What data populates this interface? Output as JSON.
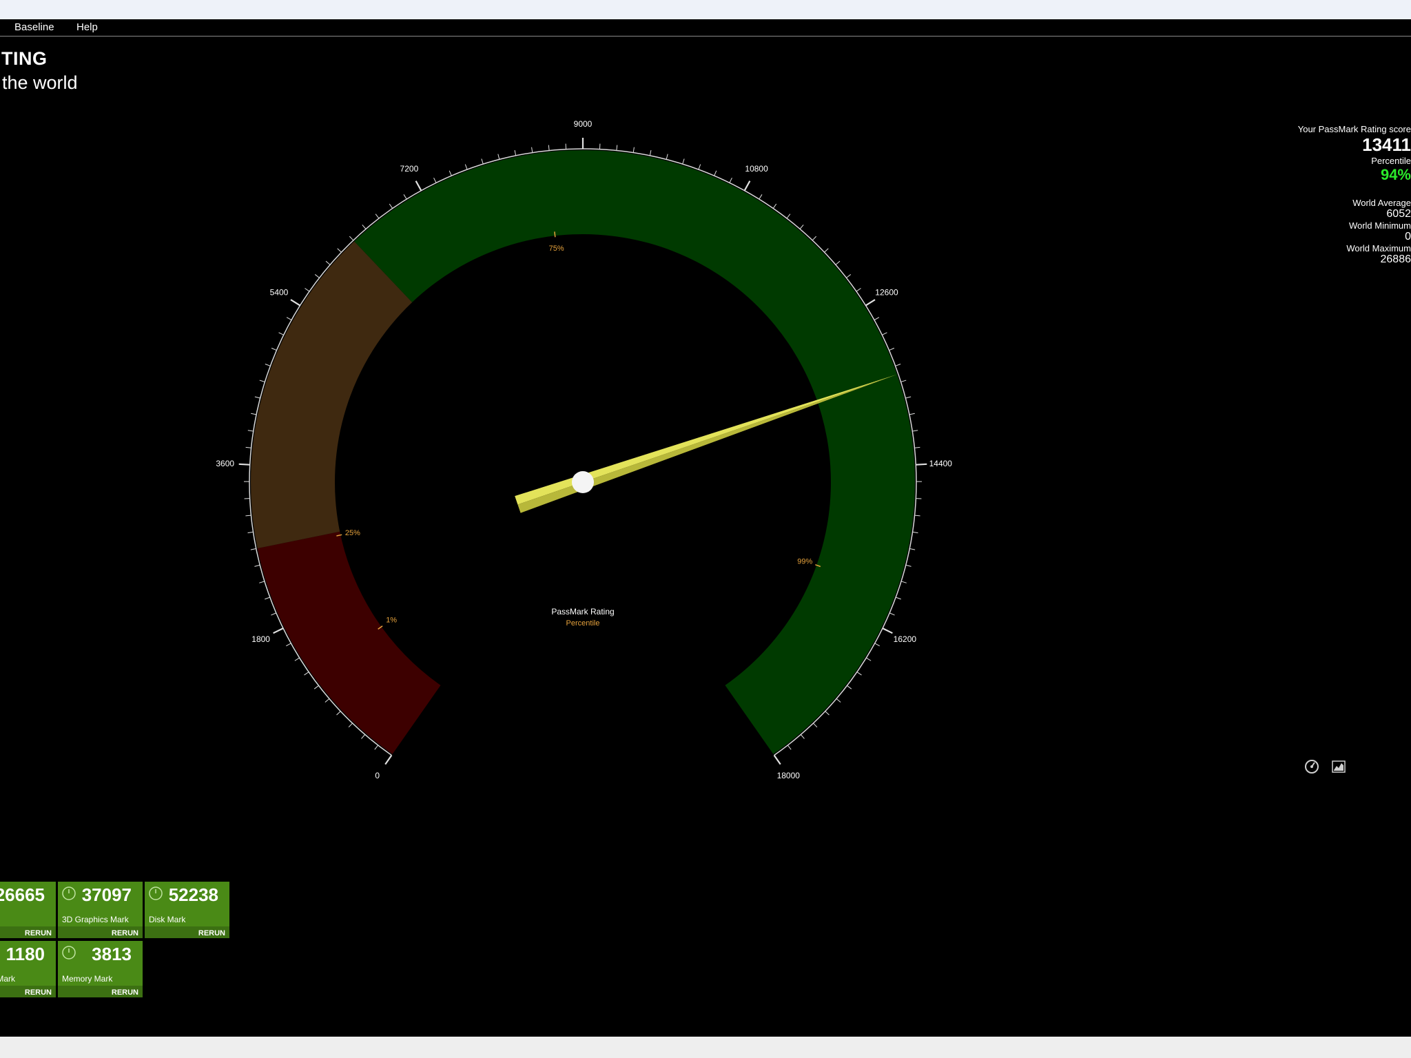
{
  "menu": {
    "items": [
      "Baseline",
      "Help"
    ]
  },
  "header": {
    "title": "TING",
    "subtitle": "the world"
  },
  "stats": {
    "score_label": "Your PassMark Rating score",
    "score": "13411",
    "percentile_label": "Percentile",
    "percentile": "94%",
    "world_avg_label": "World Average",
    "world_avg": "6052",
    "world_min_label": "World Minimum",
    "world_min": "0",
    "world_max_label": "World Maximum",
    "world_max": "26886"
  },
  "gauge": {
    "min": 0,
    "max": 18000,
    "value": 13411,
    "major_ticks": [
      "0",
      "1800",
      "3600",
      "5400",
      "7200",
      "9000",
      "10800",
      "12600",
      "14400",
      "16200",
      "18000"
    ],
    "bands": [
      {
        "from": 0,
        "to": 2700,
        "color": "#3d0000"
      },
      {
        "from": 2700,
        "to": 6300,
        "color": "#3f2910"
      },
      {
        "from": 6300,
        "to": 18000,
        "color": "#003a00"
      }
    ],
    "percentile_marks": [
      {
        "label": "1%",
        "value": 1200
      },
      {
        "label": "25%",
        "value": 2650
      },
      {
        "label": "75%",
        "value": 8600
      },
      {
        "label": "99%",
        "value": 15800
      }
    ],
    "needle_color": "#e3e35a",
    "caption": "PassMark Rating",
    "caption_sub": "Percentile",
    "caption_sub_color": "#e6a23c",
    "tick_label_color": "#ffffff",
    "percentile_label_color": "#e6a23c"
  },
  "tiles": [
    {
      "score": "26665",
      "name": "ark",
      "rerun": "RERUN",
      "icon": false
    },
    {
      "score": "37097",
      "name": "3D Graphics Mark",
      "rerun": "RERUN",
      "icon": true
    },
    {
      "score": "52238",
      "name": "Disk Mark",
      "rerun": "RERUN",
      "icon": true
    },
    {
      "score": "1180",
      "name": "phics Mark",
      "rerun": "RERUN",
      "icon": false
    },
    {
      "score": "3813",
      "name": "Memory Mark",
      "rerun": "RERUN",
      "icon": true
    }
  ],
  "icons": {
    "gauge_view": "gauge-icon",
    "chart_view": "chart-icon"
  }
}
